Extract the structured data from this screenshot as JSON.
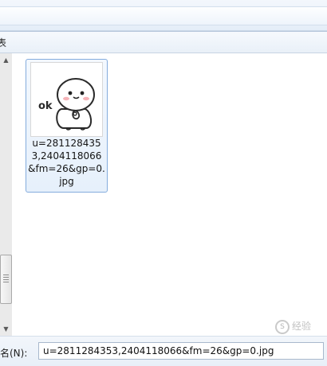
{
  "toolbar": {
    "partial_label": "表"
  },
  "scrollbar": {
    "up_glyph": "▲",
    "down_glyph": "▼"
  },
  "file_item": {
    "name": "u=2811284353,2404118066&fm=26&gp=0.jpg",
    "thumbnail_text": "ok",
    "thumbnail_icon": "cartoon-bun-ok-icon"
  },
  "bottom": {
    "filename_label": "件名(N):",
    "filename_value": "u=2811284353,2404118066&fm=26&gp=0.jpg"
  },
  "watermark": {
    "text": "经验"
  },
  "colors": {
    "selection_border": "#84acdd",
    "selection_fill": "#e6f0fb",
    "toolbar_bg": "#e9f0f8"
  }
}
